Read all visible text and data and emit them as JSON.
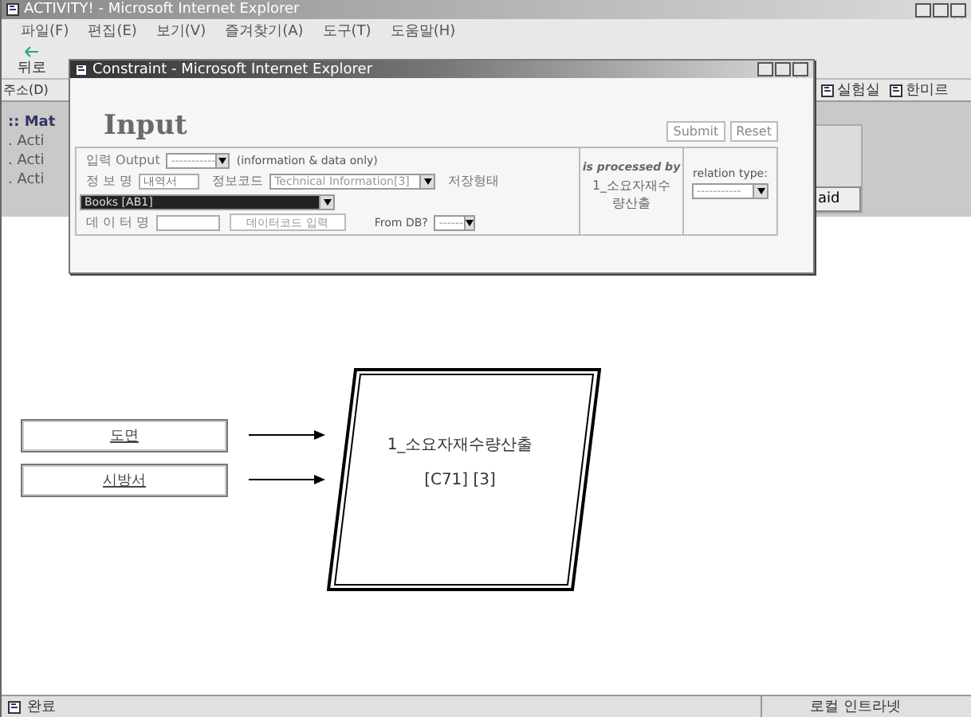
{
  "window": {
    "title": "ACTIVITY! - Microsoft Internet Explorer",
    "menu": [
      "파일(F)",
      "편집(E)",
      "보기(V)",
      "즐겨찾기(A)",
      "도구(T)",
      "도움말(H)"
    ],
    "back_label": "뒤로",
    "address_label": "주소(D)",
    "links": [
      "실험실",
      "한미르"
    ],
    "side_panel": {
      "heading": ":: Mat",
      "items": [
        ". Acti",
        ". Acti",
        ". Acti"
      ],
      "button": "aid"
    },
    "diagram": {
      "inputs": [
        "도면",
        "시방서"
      ],
      "process": {
        "name": "1_소요자재수량산출",
        "code": "[C71] [3]"
      }
    },
    "status_bar": {
      "text": "완료",
      "zone": "로컬 인트라넷"
    }
  },
  "popup": {
    "title": "Constraint - Microsoft Internet Explorer",
    "heading": "Input",
    "buttons": [
      "Submit",
      "Reset"
    ],
    "output_label": "입력 Output",
    "output_select": "-----------",
    "output_note": "(information & data only)",
    "info_name_label": "정 보 명",
    "info_name_value": "내역서",
    "info_code_label": "정보코드",
    "info_code_select": "Technical Information[3]",
    "storage_label": "저장형태",
    "storage_select": "Books [AB1]",
    "data_name_label": "데 이 터 명",
    "data_code_button": "데이터코드 입력",
    "from_db_label": "From DB?",
    "from_db_select": "------",
    "processed_label": "is processed by",
    "processed_value": "1_소요자재수량산출",
    "relation_label": "relation type:",
    "relation_select": "-----------"
  }
}
